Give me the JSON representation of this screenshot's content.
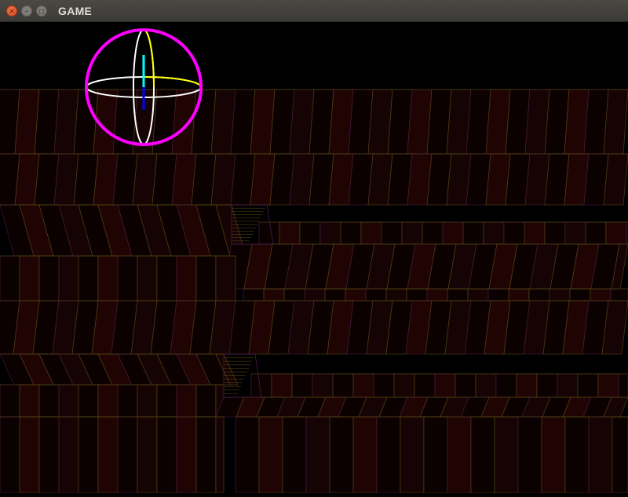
{
  "window": {
    "title": "GAME",
    "close_glyph": "×",
    "minimize_glyph": "–",
    "maximize_glyph": "□"
  },
  "colors": {
    "background": "#000000",
    "floor_fill": "#1a0303",
    "floor_line": "#5a4a14",
    "floor_line_alt": "#4a1a4a",
    "gizmo_ring": "#ff00ff",
    "gizmo_ellipse": "#ffffff",
    "gizmo_x": "#ffff00",
    "gizmo_y": "#00ffff",
    "gizmo_z": "#0000ff"
  },
  "scene": {
    "camera_gizmo": {
      "icon": "orientation-gizmo-icon"
    }
  }
}
